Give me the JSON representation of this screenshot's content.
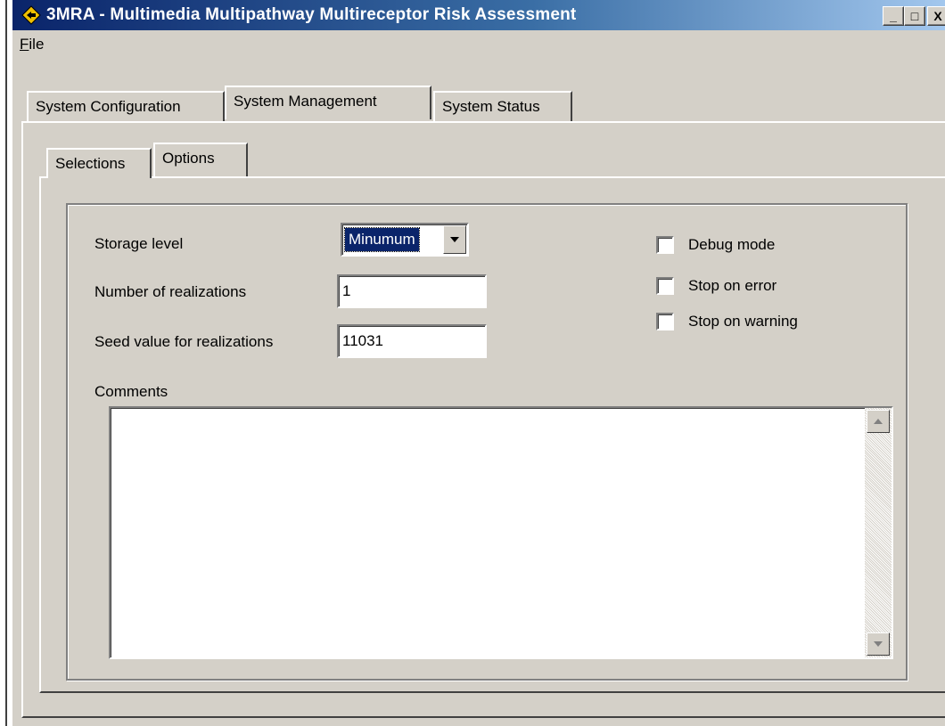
{
  "window": {
    "title": "3MRA - Multimedia Multipathway Multireceptor Risk Assessment",
    "minimize_label": "_",
    "maximize_label": "□",
    "close_label": "X"
  },
  "menu": {
    "file_label_accel": "F",
    "file_label_rest": "ile"
  },
  "main_tabs": [
    {
      "label": "System Configuration",
      "active": false
    },
    {
      "label": "System Management",
      "active": true
    },
    {
      "label": "System Status",
      "active": false
    }
  ],
  "sub_tabs": [
    {
      "label": "Selections",
      "active": false
    },
    {
      "label": "Options",
      "active": true
    }
  ],
  "options": {
    "storage_level_label": "Storage level",
    "storage_level_value": "Minumum",
    "realizations_label": "Number of realizations",
    "realizations_value": "1",
    "seed_label": "Seed value for realizations",
    "seed_value": "11031",
    "comments_label": "Comments",
    "comments_value": ""
  },
  "checkboxes": [
    {
      "label": "Debug mode",
      "checked": false
    },
    {
      "label": "Stop on error",
      "checked": false
    },
    {
      "label": "Stop on warning",
      "checked": false
    }
  ],
  "colors": {
    "title_gradient_start": "#0a246a",
    "title_gradient_end": "#a6caf0",
    "face": "#d4d0c8",
    "selection": "#0a246a"
  }
}
